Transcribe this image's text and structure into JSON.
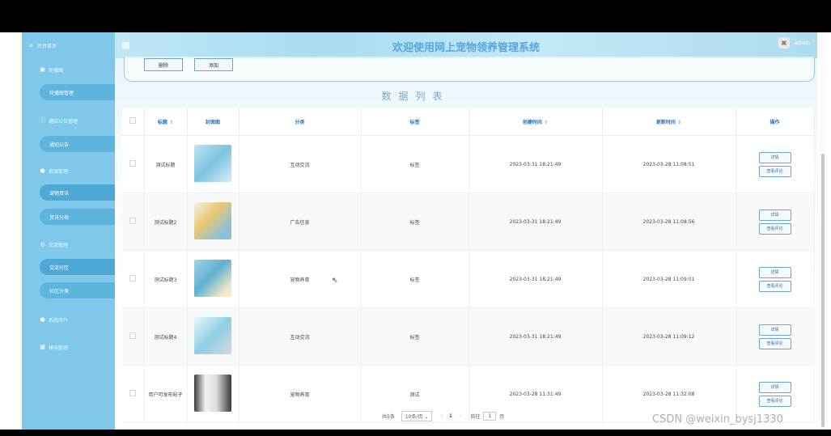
{
  "sidebar": {
    "home": "后台首页",
    "carousel_group": "轮播图",
    "carousel_manage": "轮播图管理",
    "notice_group": "通知公告管理",
    "notice": "通知公告",
    "resource_group": "资源管理",
    "pet_info": "宠物资讯",
    "info_category": "资讯分类",
    "community_group": "交流管理",
    "community": "交流社区",
    "community_category": "社区分类",
    "users": "系统用户",
    "modules": "模块管理"
  },
  "header": {
    "title": "欢迎使用网上宠物领养管理系统",
    "user": "admin"
  },
  "actions": {
    "delete": "删除",
    "add": "添加"
  },
  "list_title": "数据列表",
  "table": {
    "columns": [
      "标题",
      "封面图",
      "分类",
      "标签",
      "创建时间",
      "更新时间",
      "操作"
    ],
    "rows": [
      {
        "title": "测试标题",
        "category": "互动交流",
        "tag": "标签",
        "created": "2023-03-31 18:21:49",
        "updated": "2023-03-28 11:08:51"
      },
      {
        "title": "测试标题2",
        "category": "广告信息",
        "tag": "标签",
        "created": "2023-03-31 18:21:49",
        "updated": "2023-03-28 11:08:56"
      },
      {
        "title": "测试标题3",
        "category": "宠物养育",
        "tag": "标签",
        "created": "2023-03-31 18:21:49",
        "updated": "2023-03-28 11:09:01"
      },
      {
        "title": "测试标题4",
        "category": "互动交流",
        "tag": "标签",
        "created": "2023-03-31 18:21:49",
        "updated": "2023-03-28 11:09:12"
      },
      {
        "title": "用户可发布帖子",
        "category": "宠物养育",
        "tag": "测试",
        "created": "2023-03-28 11:31:49",
        "updated": "2023-03-28 11:32:08"
      }
    ],
    "op_detail": "详情",
    "op_comments": "查看评论"
  },
  "pager": {
    "total": "共5条",
    "page_size": "10条/页",
    "current": "1",
    "goto_prefix": "前往",
    "goto_value": "1",
    "goto_suffix": "页"
  },
  "watermark": "CSDN @weixin_bysj1330"
}
